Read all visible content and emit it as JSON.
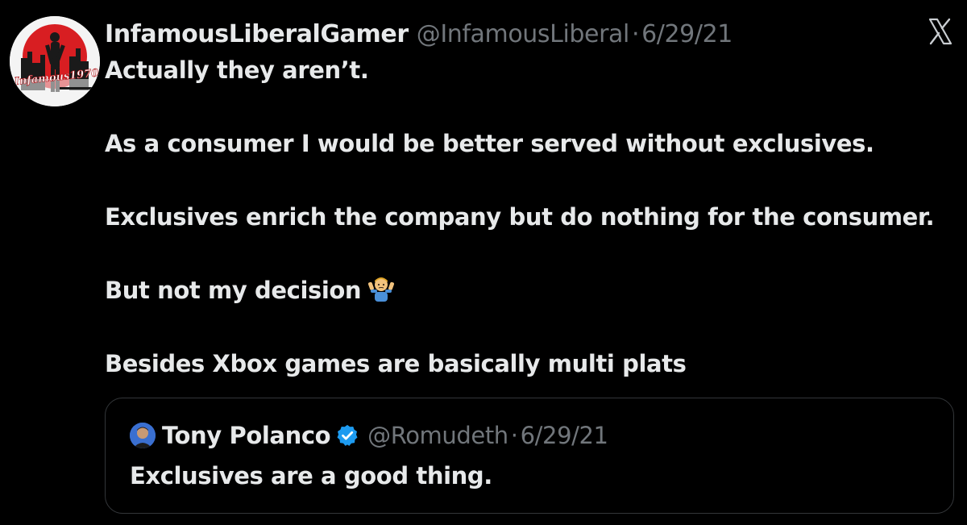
{
  "tweet": {
    "author": {
      "display_name": "InfamousLiberalGamer",
      "handle": "@InfamousLiberal",
      "avatar_icon": "avatar-image",
      "avatar_text": "Infamous1970"
    },
    "separator": "·",
    "date": "6/29/21",
    "close_icon": "x-icon",
    "paragraphs": [
      "Actually they aren’t.",
      "As a consumer I would be better served without exclusives.",
      "Exclusives enrich the company but do nothing for the consumer.",
      "But not my decision",
      "Besides Xbox games are basically multi plats"
    ],
    "emoji": "shrug-emoji"
  },
  "quoted_tweet": {
    "author": {
      "display_name": "Tony Polanco",
      "handle": "@Romudeth",
      "verified_icon": "verified-badge-icon",
      "verified_color": "#1d9bf0"
    },
    "separator": "·",
    "date": "6/29/21",
    "text": "Exclusives are a good thing."
  },
  "colors": {
    "background": "#000000",
    "primary_text": "#e7e9ea",
    "secondary_text": "#71767b",
    "border": "#333639"
  }
}
